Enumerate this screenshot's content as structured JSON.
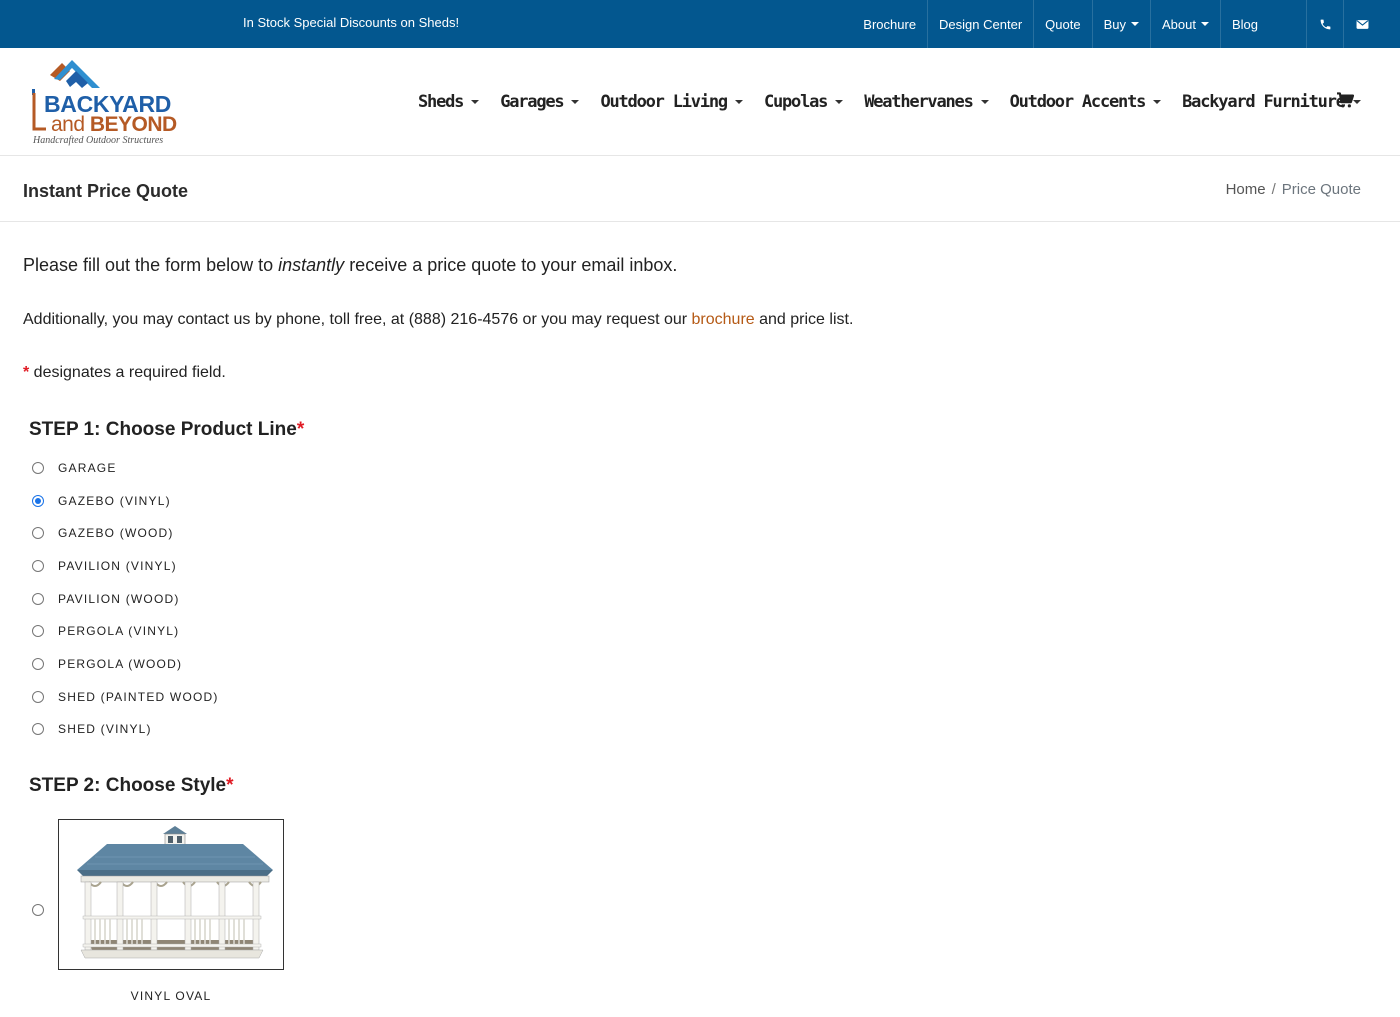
{
  "topbar": {
    "promo": "In Stock Special Discounts on Sheds!",
    "links": [
      {
        "label": "Brochure"
      },
      {
        "label": "Design Center"
      },
      {
        "label": "Quote"
      },
      {
        "label": "Buy"
      },
      {
        "label": "About"
      },
      {
        "label": "Blog"
      }
    ],
    "icons": [
      "phone-icon",
      "email-icon"
    ]
  },
  "logo": {
    "line1": "BACKYARD",
    "line2_a": "and ",
    "line2_b": "BEYOND",
    "tagline": "Handcrafted Outdoor Structures"
  },
  "main_nav": [
    {
      "label": "Sheds"
    },
    {
      "label": "Garages"
    },
    {
      "label": "Outdoor Living"
    },
    {
      "label": "Cupolas"
    },
    {
      "label": "Weathervanes"
    },
    {
      "label": "Outdoor Accents"
    },
    {
      "label": "Backyard Furniture"
    }
  ],
  "page": {
    "title": "Instant Price Quote",
    "breadcrumb": {
      "home": "Home",
      "sep": "/",
      "current": "Price Quote"
    }
  },
  "intro": {
    "before": "Please fill out the form below to ",
    "emph": "instantly",
    "after": " receive a price quote to your email inbox."
  },
  "contact": {
    "before": "Additionally, you may contact us by phone, toll free, at (888) 216-4576 or you may request our ",
    "link": "brochure",
    "after": " and price list."
  },
  "required_note": {
    "star": "*",
    "text": " designates a required field."
  },
  "step1": {
    "prefix": "STEP 1:",
    "label": " Choose Product Line",
    "star": "*",
    "options": [
      {
        "label": "GARAGE",
        "checked": false
      },
      {
        "label": "GAZEBO (VINYL)",
        "checked": true
      },
      {
        "label": "GAZEBO (WOOD)",
        "checked": false
      },
      {
        "label": "PAVILION (VINYL)",
        "checked": false
      },
      {
        "label": "PAVILION (WOOD)",
        "checked": false
      },
      {
        "label": "PERGOLA (VINYL)",
        "checked": false
      },
      {
        "label": "PERGOLA (WOOD)",
        "checked": false
      },
      {
        "label": "SHED (PAINTED WOOD)",
        "checked": false
      },
      {
        "label": "SHED (VINYL)",
        "checked": false
      }
    ]
  },
  "step2": {
    "prefix": "STEP 2:",
    "label": " Choose Style",
    "star": "*",
    "styles": [
      {
        "label": "VINYL OVAL",
        "checked": false
      }
    ]
  },
  "colors": {
    "topbar_bg": "#03578f",
    "link_brown": "#b55a16",
    "required_red": "#e01b24",
    "logo_blue": "#1f5fa8",
    "logo_brown": "#b55a25"
  }
}
